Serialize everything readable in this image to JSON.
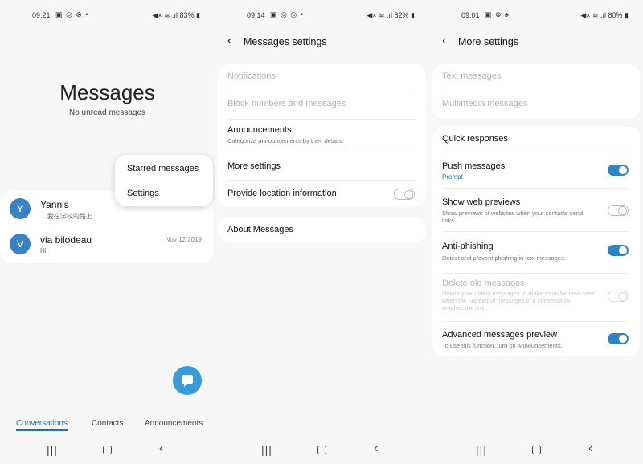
{
  "screen1": {
    "status": {
      "time": "09:21",
      "icons": "▣ ◎ ⊗ •",
      "right": "◀× ≋ .ıl 83% ▮"
    },
    "title": "Messages",
    "subtitle": "No unread messages",
    "popup": [
      "Starred messages",
      "Settings"
    ],
    "conversations": [
      {
        "avatar": "Y",
        "name": "Yannis",
        "preview": "... 我在学校的路上",
        "date": ""
      },
      {
        "avatar": "V",
        "name": "via bilodeau",
        "preview": "Hi",
        "date": "Nov 12 2019"
      }
    ],
    "tabs": [
      "Conversations",
      "Contacts",
      "Announcements"
    ]
  },
  "screen2": {
    "status": {
      "time": "09:14",
      "icons": "▣ ◎ ◎ •",
      "right": "◀× ≋ .ıl 82% ▮"
    },
    "title": "Messages settings",
    "items": {
      "notifications": "Notifications",
      "block": "Block numbers and messages",
      "announcements": "Announcements",
      "announcements_desc": "Categorize announcements by their details.",
      "more": "More settings",
      "location": "Provide location information",
      "about": "About Messages"
    }
  },
  "screen3": {
    "status": {
      "time": "09:01",
      "icons": "▣ ⊗ ♠",
      "right": "◀× ≋ .ıl 80% ▮"
    },
    "title": "More settings",
    "items": {
      "text": "Text messages",
      "multimedia": "Multimedia messages",
      "quick": "Quick responses",
      "push": "Push messages",
      "push_sub": "Prompt",
      "web": "Show web previews",
      "web_desc": "Show previews of websites when your contacts send links.",
      "phishing": "Anti-phishing",
      "phishing_desc": "Detect and prevent phishing in text messages.",
      "delete": "Delete old messages",
      "delete_desc": "Delete your oldest messages to make room for new ones when the number of messages in a conversation reaches the limit.",
      "advanced": "Advanced messages preview",
      "advanced_desc": "To use this function, turn on Announcements."
    },
    "toggles": {
      "push": true,
      "web": false,
      "phishing": true,
      "delete": false,
      "advanced": true
    }
  },
  "navbar": {
    "recent": "|||",
    "back": "‹"
  },
  "colors": {
    "accent": "#2e86c1",
    "fab": "#3b9ad9",
    "avatar": "#3b82c4"
  }
}
